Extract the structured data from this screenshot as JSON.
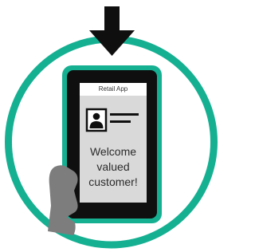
{
  "app": {
    "title": "Retail App"
  },
  "screen": {
    "welcome_lines": [
      "Welcome",
      "valued",
      "customer!"
    ]
  },
  "icons": {
    "arrow": "down-arrow-icon",
    "ring": "circle-ring",
    "profile": "id-card-icon",
    "hand": "hand-icon"
  },
  "colors": {
    "ring": "#15b092",
    "tablet_border": "#15b092",
    "tablet_body": "#0f0f0f",
    "screen_bg": "#d9d9d9",
    "header_bg": "#ffffff",
    "hand": "#7d7d7d",
    "arrow": "#0f0f0f"
  }
}
